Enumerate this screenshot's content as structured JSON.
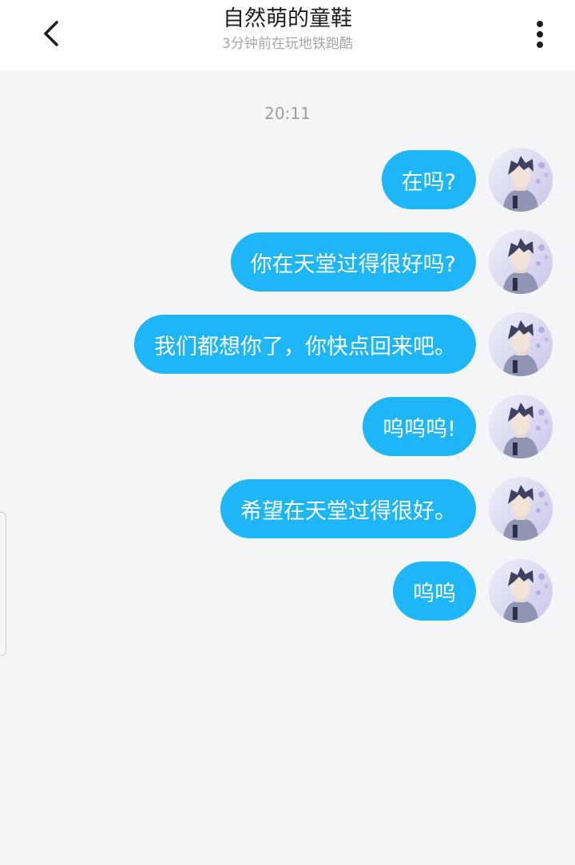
{
  "header": {
    "back_icon": "chevron-left-icon",
    "title": "自然萌的童鞋",
    "subtitle": "3分钟前在玩地铁跑酷",
    "more_icon": "vertical-dots-icon"
  },
  "chat": {
    "timestamp": "20:11",
    "messages": [
      {
        "text": "在吗?"
      },
      {
        "text": "你在天堂过得很好吗?"
      },
      {
        "text": "我们都想你了，你快点回来吧。"
      },
      {
        "text": "呜呜呜!"
      },
      {
        "text": "希望在天堂过得很好。"
      },
      {
        "text": "呜呜"
      }
    ]
  },
  "colors": {
    "bubble": "#1eb6f7",
    "background": "#f4f5f7",
    "header_bg": "#ffffff"
  }
}
